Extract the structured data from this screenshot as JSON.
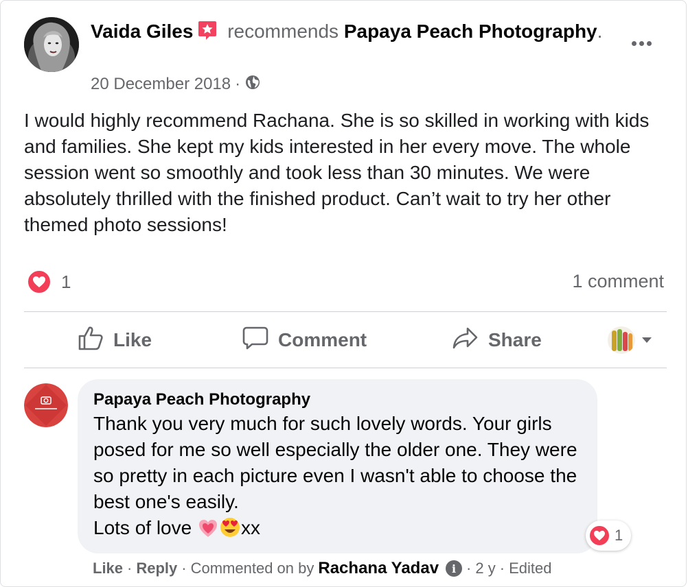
{
  "post": {
    "author": "Vaida Giles",
    "verb": "recommends",
    "page": "Papaya Peach Photography",
    "period": ".",
    "date": "20 December 2018",
    "date_sep": "·",
    "privacy_icon": "globe-icon",
    "recommend_icon": "star-badge-icon",
    "body": "I would highly recommend Rachana. She is so skilled in working with kids and families. She kept my kids interested in her every move. The whole session went so smoothly and took less than 30 minutes. We were absolutely thrilled with the finished product. Can’t wait to try her other themed photo sessions!",
    "reaction_count": "1",
    "comment_count": "1 comment"
  },
  "actions": {
    "like": "Like",
    "comment": "Comment",
    "share": "Share"
  },
  "comment": {
    "author": "Papaya Peach Photography",
    "text_main": "Thank you very much for such lovely words. Your girls posed for me so well especially the older one. They were so pretty in each picture even I wasn't able to choose the best one's easily.",
    "text_last": "Lots of love ",
    "text_tail": "xx",
    "reaction_count": "1",
    "like": "Like",
    "reply": "Reply",
    "commented_on_by": "Commented on by",
    "by_name": "Rachana Yadav",
    "age": "2 y",
    "edited": "Edited",
    "sep": "·"
  },
  "colors": {
    "love": "#f33e58",
    "secondary_text": "#65676b",
    "bubble": "#f0f2f5",
    "recommend": "#f3425f"
  }
}
